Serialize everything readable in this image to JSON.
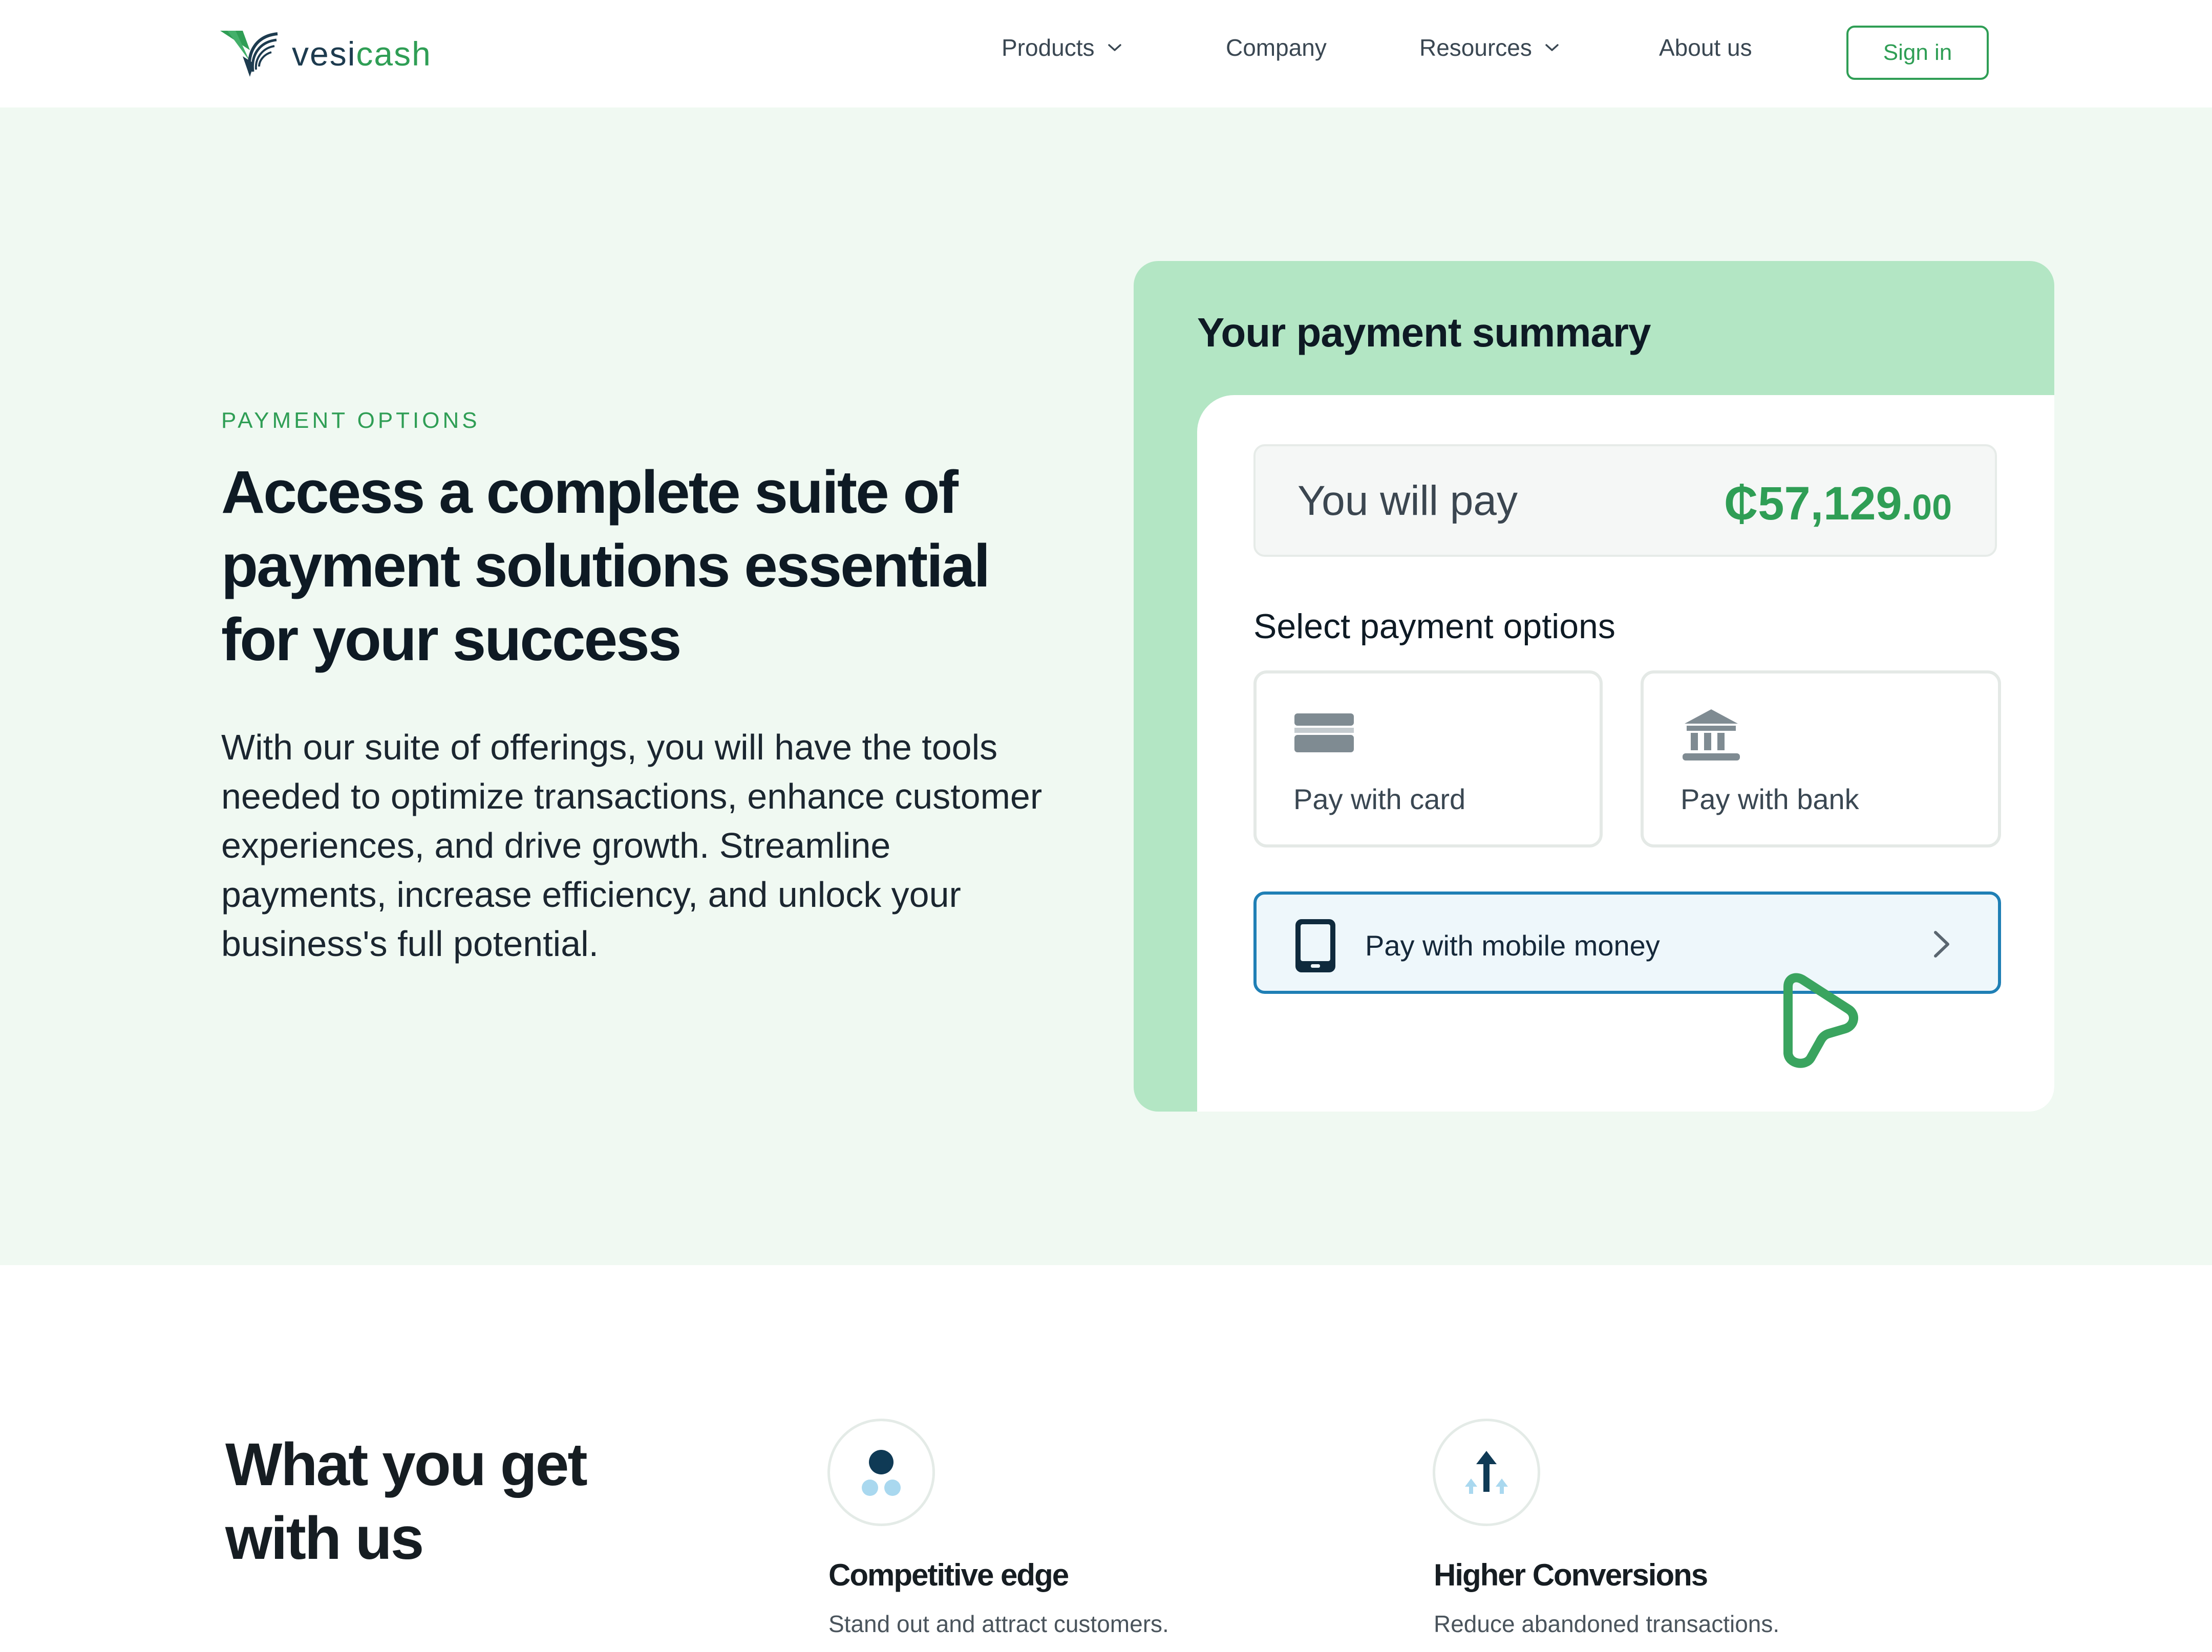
{
  "header": {
    "logo": {
      "name": "vesicash",
      "part_a": "vesi",
      "part_b": "cash"
    },
    "nav": [
      {
        "label": "Products",
        "has_dropdown": true
      },
      {
        "label": "Company",
        "has_dropdown": false
      },
      {
        "label": "Resources",
        "has_dropdown": true
      },
      {
        "label": "About us",
        "has_dropdown": false
      }
    ],
    "sign_in_label": "Sign in"
  },
  "hero": {
    "eyebrow": "PAYMENT OPTIONS",
    "headline": "Access a complete suite of payment solutions essential for your success",
    "body": "With our suite of offerings, you will have the tools needed to optimize transactions, enhance customer experiences, and drive growth. Streamline payments, increase efficiency, and unlock your business's full potential."
  },
  "payment_card": {
    "title": "Your payment summary",
    "pay_label": "You will pay",
    "amount_main": "₵57,129",
    "amount_cents": ".00",
    "select_title": "Select payment options",
    "options": [
      {
        "label": "Pay with card",
        "icon": "credit-card-icon"
      },
      {
        "label": "Pay with bank",
        "icon": "bank-icon"
      }
    ],
    "mobile_option": {
      "label": "Pay with mobile money",
      "icon": "mobile-phone-icon",
      "selected": true
    }
  },
  "benefits": {
    "title": "What you get with us",
    "features": [
      {
        "title": "Competitive edge",
        "description": "Stand out and attract customers.",
        "icon": "competitive-edge-icon"
      },
      {
        "title": "Higher Conversions",
        "description": "Reduce abandoned transactions.",
        "icon": "conversions-arrow-icon"
      }
    ]
  },
  "colors": {
    "brand_green": "#2f9e55",
    "hero_background": "#f0f9f2",
    "card_green": "#b3e6c4",
    "selected_border": "#1f7fb5",
    "dark_navy": "#0e1a24"
  }
}
